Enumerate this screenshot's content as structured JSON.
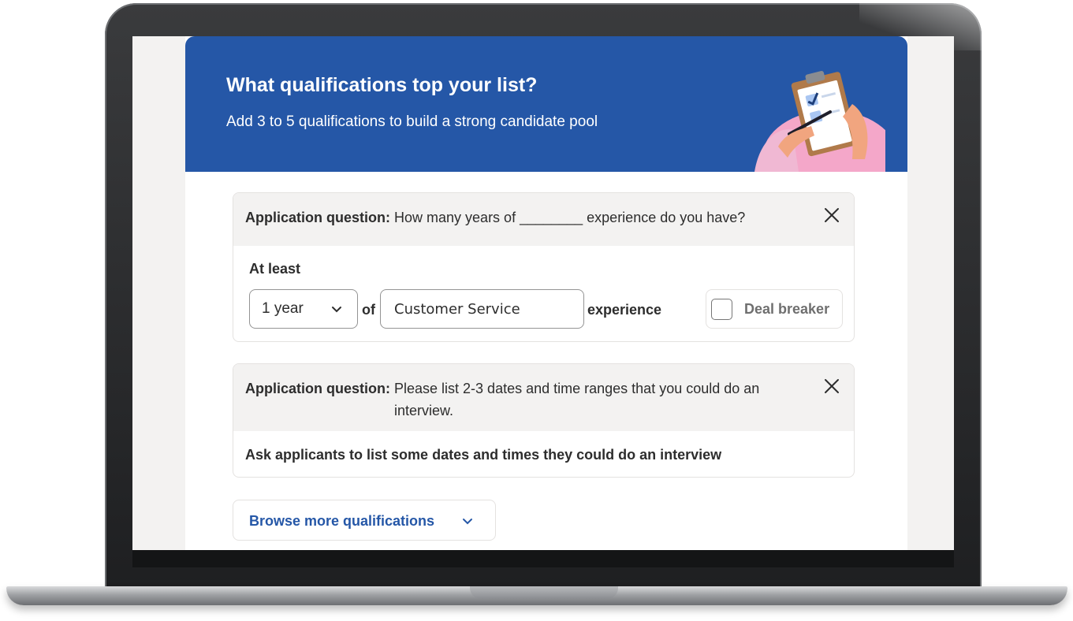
{
  "hero": {
    "title": "What qualifications top your list?",
    "subtitle": "Add 3 to 5 qualifications to build a strong candidate pool",
    "illustration": "clipboard-checklist-hands"
  },
  "qualifications": [
    {
      "label": "Application question:",
      "question": "How many years of ________ experience do you have?",
      "at_least_label": "At least",
      "years_value": "1 year",
      "of_label": "of",
      "experience_value": "Customer Service",
      "experience_label": "experience",
      "dealbreaker_label": "Deal breaker",
      "dealbreaker_checked": false,
      "close_icon": "close-icon"
    },
    {
      "label": "Application question:",
      "question": "Please list 2-3 dates and time ranges that you could do an interview.",
      "description": "Ask applicants to list some dates and times they could do an interview",
      "close_icon": "close-icon"
    }
  ],
  "browse": {
    "label": "Browse more qualifications",
    "icon": "chevron-down-icon"
  },
  "colors": {
    "brand_blue": "#2557a7",
    "card_header_bg": "#f3f2f1",
    "text": "#2d2d2d",
    "illustration_pink": "#f4a7c9"
  }
}
